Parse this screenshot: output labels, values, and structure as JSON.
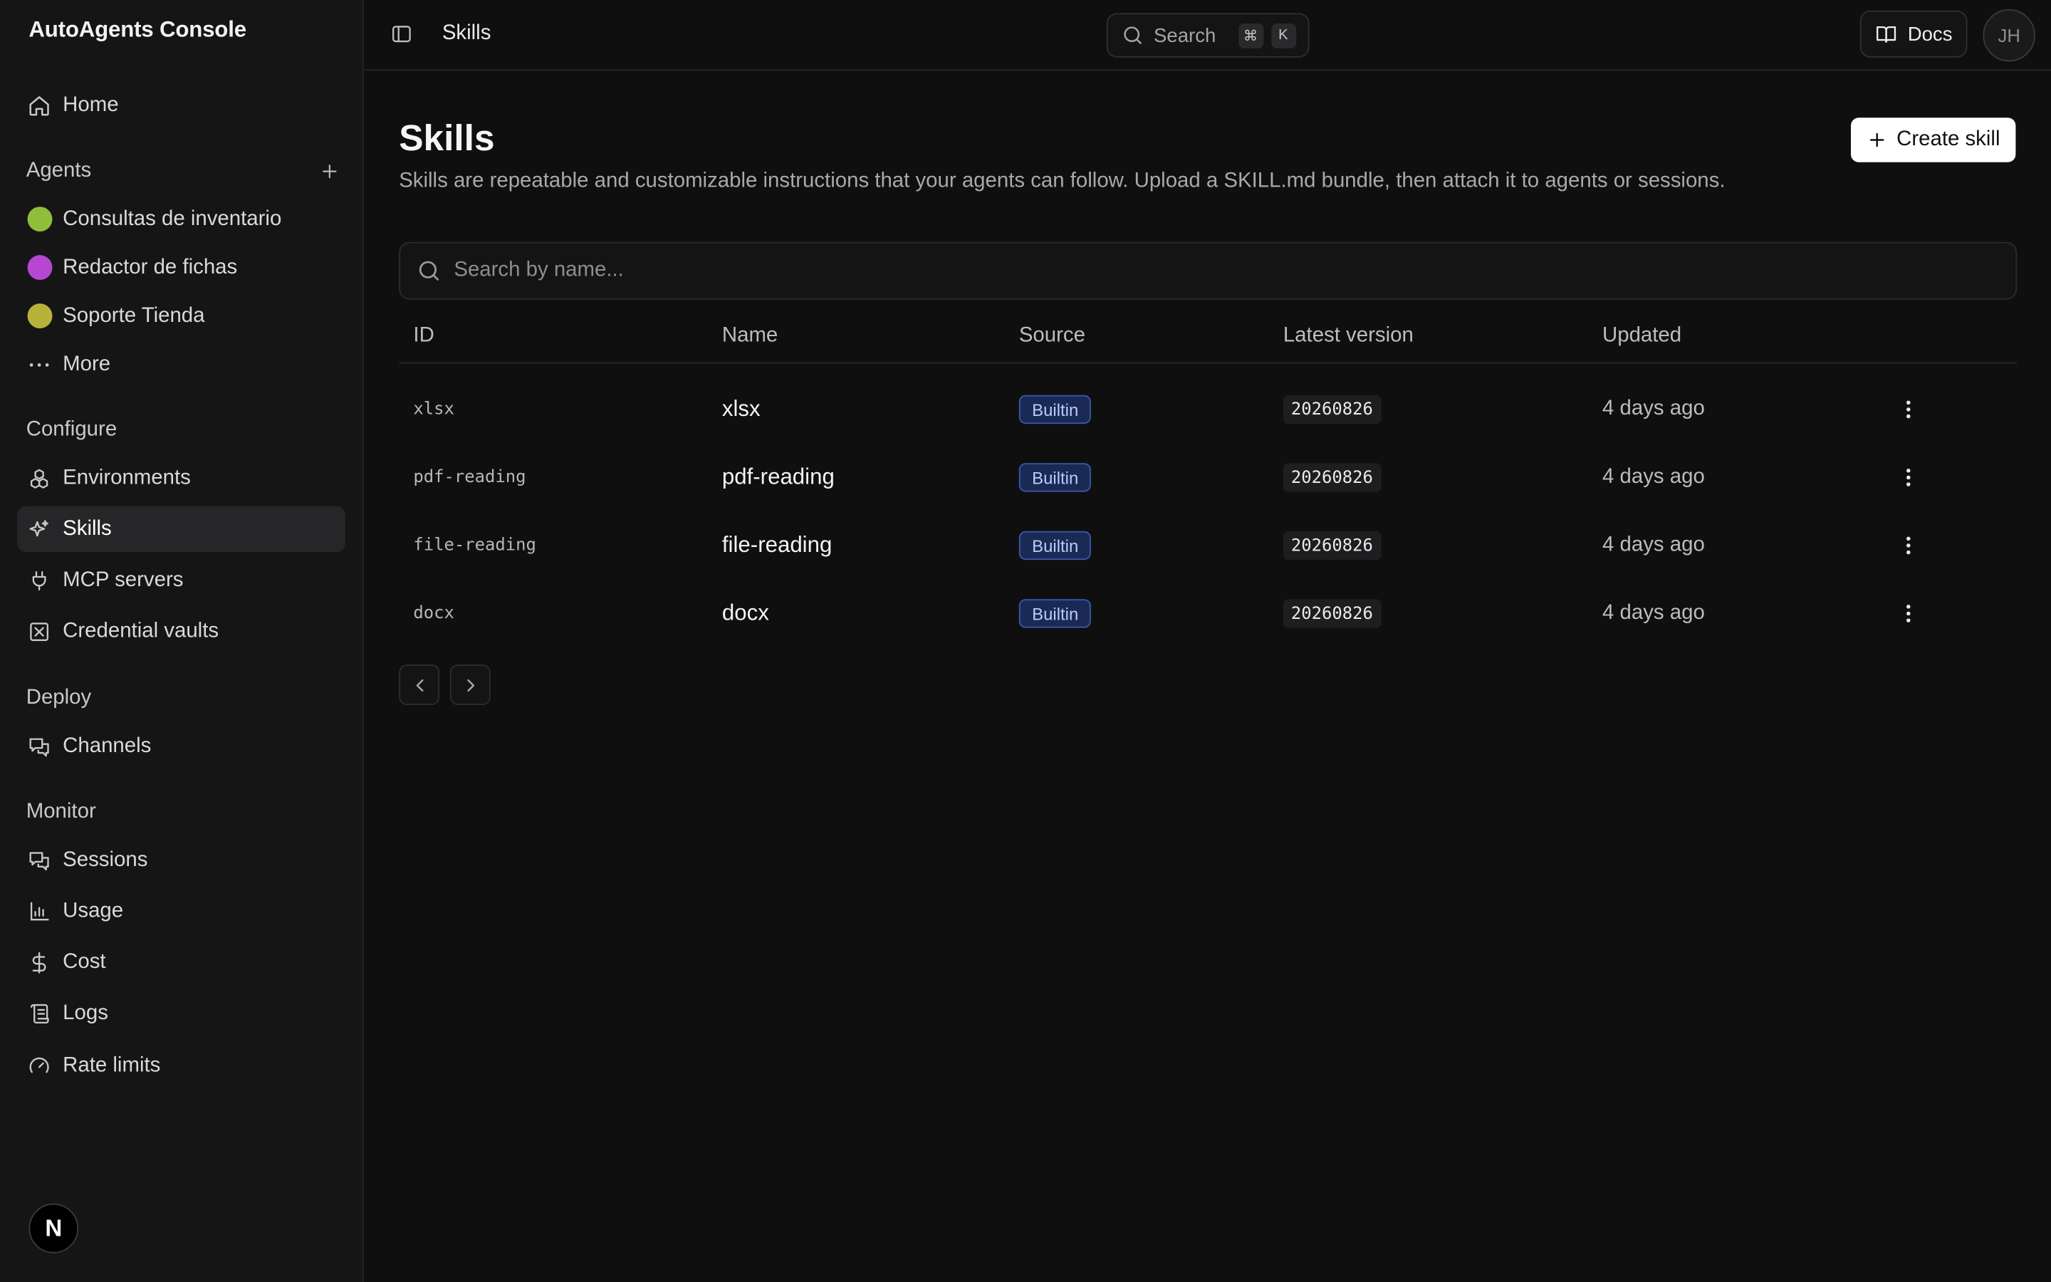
{
  "app": {
    "title": "AutoAgents Console"
  },
  "sidebar": {
    "home_label": "Home",
    "agents_label": "Agents",
    "agents": [
      {
        "label": "Consultas de inventario",
        "color": "#8fbf3a"
      },
      {
        "label": "Redactor de fichas",
        "color": "#b547d1"
      },
      {
        "label": "Soporte Tienda",
        "color": "#b8b23a"
      }
    ],
    "more_label": "More",
    "configure_label": "Configure",
    "configure_items": [
      {
        "label": "Environments",
        "icon": "boxes-icon"
      },
      {
        "label": "Skills",
        "icon": "sparkles-icon",
        "active": true
      },
      {
        "label": "MCP servers",
        "icon": "plug-icon"
      },
      {
        "label": "Credential vaults",
        "icon": "vault-icon"
      }
    ],
    "deploy_label": "Deploy",
    "deploy_items": [
      {
        "label": "Channels",
        "icon": "chat-icon"
      }
    ],
    "monitor_label": "Monitor",
    "monitor_items": [
      {
        "label": "Sessions",
        "icon": "chat-icon"
      },
      {
        "label": "Usage",
        "icon": "bar-chart-icon"
      },
      {
        "label": "Cost",
        "icon": "dollar-icon"
      },
      {
        "label": "Logs",
        "icon": "scroll-icon"
      },
      {
        "label": "Rate limits",
        "icon": "gauge-icon"
      }
    ],
    "footer_badge": "N"
  },
  "topbar": {
    "breadcrumb": "Skills",
    "search_label": "Search",
    "search_kbd": [
      "⌘",
      "K"
    ],
    "docs_label": "Docs",
    "avatar_initials": "JH"
  },
  "main": {
    "title": "Skills",
    "description": "Skills are repeatable and customizable instructions that your agents can follow. Upload a SKILL.md bundle, then attach it to agents or sessions.",
    "create_label": "Create skill",
    "search_placeholder": "Search by name...",
    "table": {
      "headers": [
        "ID",
        "Name",
        "Source",
        "Latest version",
        "Updated"
      ],
      "rows": [
        {
          "id": "xlsx",
          "name": "xlsx",
          "source": "Builtin",
          "version": "20260826",
          "updated": "4 days ago"
        },
        {
          "id": "pdf-reading",
          "name": "pdf-reading",
          "source": "Builtin",
          "version": "20260826",
          "updated": "4 days ago"
        },
        {
          "id": "file-reading",
          "name": "file-reading",
          "source": "Builtin",
          "version": "20260826",
          "updated": "4 days ago"
        },
        {
          "id": "docx",
          "name": "docx",
          "source": "Builtin",
          "version": "20260826",
          "updated": "4 days ago"
        }
      ]
    }
  },
  "colors": {
    "accent_badge_bg": "#1b2a55",
    "accent_badge_border": "#3b58a8",
    "primary_button": "#ffffff"
  }
}
